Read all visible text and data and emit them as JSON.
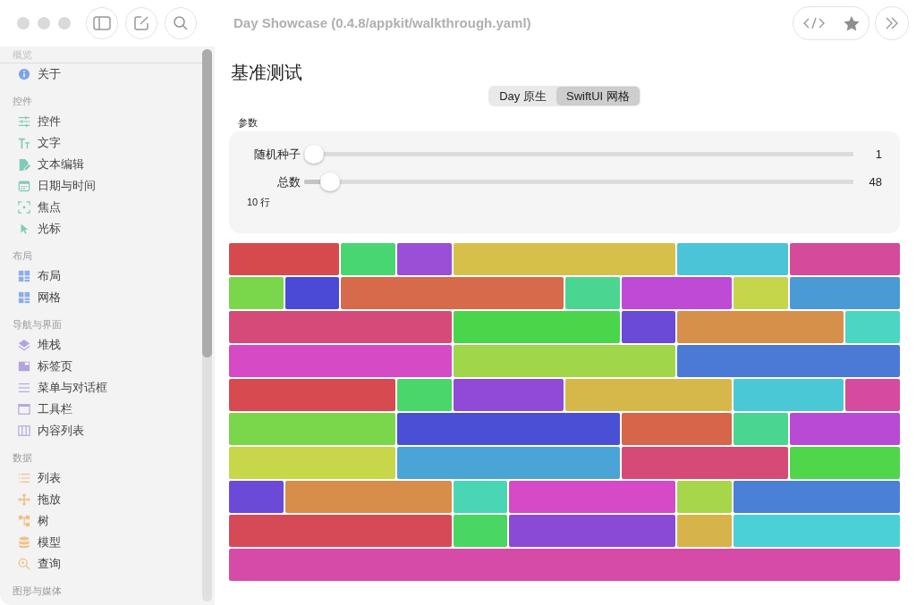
{
  "window": {
    "title": "Day Showcase (0.4.8/appkit/walkthrough.yaml)"
  },
  "sidebar": {
    "sections": [
      {
        "heading": "概览",
        "items": [
          {
            "label": "关于",
            "kind": "info"
          }
        ]
      },
      {
        "heading": "控件",
        "items": [
          {
            "label": "控件",
            "kind": "sliders"
          },
          {
            "label": "文字",
            "kind": "text"
          },
          {
            "label": "文本编辑",
            "kind": "doc"
          },
          {
            "label": "日期与时间",
            "kind": "calendar"
          },
          {
            "label": "焦点",
            "kind": "focus"
          },
          {
            "label": "光标",
            "kind": "cursor"
          }
        ]
      },
      {
        "heading": "布局",
        "items": [
          {
            "label": "布局",
            "kind": "grid"
          },
          {
            "label": "网格",
            "kind": "grid"
          }
        ]
      },
      {
        "heading": "导航与界面",
        "items": [
          {
            "label": "堆栈",
            "kind": "stack"
          },
          {
            "label": "标签页",
            "kind": "tabs"
          },
          {
            "label": "菜单与对话框",
            "kind": "lines"
          },
          {
            "label": "工具栏",
            "kind": "window"
          },
          {
            "label": "内容列表",
            "kind": "columns"
          }
        ]
      },
      {
        "heading": "数据",
        "items": [
          {
            "label": "列表",
            "kind": "list"
          },
          {
            "label": "拖放",
            "kind": "move"
          },
          {
            "label": "树",
            "kind": "tree"
          },
          {
            "label": "模型",
            "kind": "database"
          },
          {
            "label": "查询",
            "kind": "search"
          }
        ]
      },
      {
        "heading": "图形与媒体"
      }
    ]
  },
  "page": {
    "title": "基准测试",
    "segments": [
      {
        "label": "Day 原生",
        "selected": false
      },
      {
        "label": "SwiftUI 网格",
        "selected": true
      }
    ],
    "params_label": "参数",
    "sliders": [
      {
        "label": "随机种子",
        "level": 0.0,
        "reading": "1"
      },
      {
        "label": "总数",
        "level": 0.03,
        "reading": "48"
      }
    ],
    "row_count": "10 行",
    "mosaic": [
      [
        {
          "kind": "double",
          "color": "#d64a4e"
        },
        {
          "kind": "single",
          "color": "#48d672"
        },
        {
          "kind": "single",
          "color": "#9b4ed6"
        },
        {
          "kind": "quadruple",
          "color": "#d6c04a"
        },
        {
          "kind": "double",
          "color": "#4ac4d6"
        },
        {
          "kind": "double",
          "color": "#d64a9b"
        }
      ],
      [
        {
          "kind": "single",
          "color": "#7ad64a"
        },
        {
          "kind": "single",
          "color": "#4a4ad6"
        },
        {
          "kind": "quadruple",
          "color": "#d66a4a"
        },
        {
          "kind": "single",
          "color": "#4ad690"
        },
        {
          "kind": "double",
          "color": "#bf4ad6"
        },
        {
          "kind": "single",
          "color": "#c6d64a"
        },
        {
          "kind": "double",
          "color": "#4a9ad6"
        }
      ],
      [
        {
          "kind": "quadruple",
          "color": "#d64a7a"
        },
        {
          "kind": "triple",
          "color": "#4ad64a"
        },
        {
          "kind": "single",
          "color": "#6a4ad6"
        },
        {
          "kind": "triple",
          "color": "#d6904a"
        },
        {
          "kind": "single",
          "color": "#4ad6c0"
        }
      ],
      [
        {
          "kind": "quadruple",
          "color": "#d64ac6"
        },
        {
          "kind": "quadruple",
          "color": "#a0d64a"
        },
        {
          "kind": "quadruple",
          "color": "#4a7ad6"
        }
      ],
      [
        {
          "kind": "triple",
          "color": "#d64a50"
        },
        {
          "kind": "single",
          "color": "#4ad66a"
        },
        {
          "kind": "double",
          "color": "#904ad6"
        },
        {
          "kind": "triple",
          "color": "#d6b84a"
        },
        {
          "kind": "double",
          "color": "#4ac8d6"
        },
        {
          "kind": "single",
          "color": "#d64aa0"
        }
      ],
      [
        {
          "kind": "triple",
          "color": "#7ad64a"
        },
        {
          "kind": "quadruple",
          "color": "#4a50d6"
        },
        {
          "kind": "double",
          "color": "#d6654a"
        },
        {
          "kind": "single",
          "color": "#4ad690"
        },
        {
          "kind": "double",
          "color": "#b84ad6"
        }
      ],
      [
        {
          "kind": "triple",
          "color": "#c8d64a"
        },
        {
          "kind": "quadruple",
          "color": "#4aa4d6"
        },
        {
          "kind": "triple",
          "color": "#d64a78"
        },
        {
          "kind": "double",
          "color": "#50d64a"
        }
      ],
      [
        {
          "kind": "single",
          "color": "#6a4ad6"
        },
        {
          "kind": "triple",
          "color": "#d68e4a"
        },
        {
          "kind": "single",
          "color": "#4ad6b4"
        },
        {
          "kind": "triple",
          "color": "#d64ac8"
        },
        {
          "kind": "single",
          "color": "#a8d64a"
        },
        {
          "kind": "triple",
          "color": "#4a80d6"
        }
      ],
      [
        {
          "kind": "quadruple",
          "color": "#d64a58"
        },
        {
          "kind": "single",
          "color": "#4ad662"
        },
        {
          "kind": "triple",
          "color": "#8a4ad6"
        },
        {
          "kind": "single",
          "color": "#d6b44a"
        },
        {
          "kind": "triple",
          "color": "#4ad0d6"
        }
      ],
      [
        {
          "kind": "full",
          "color": "#d64aa8"
        }
      ]
    ]
  }
}
